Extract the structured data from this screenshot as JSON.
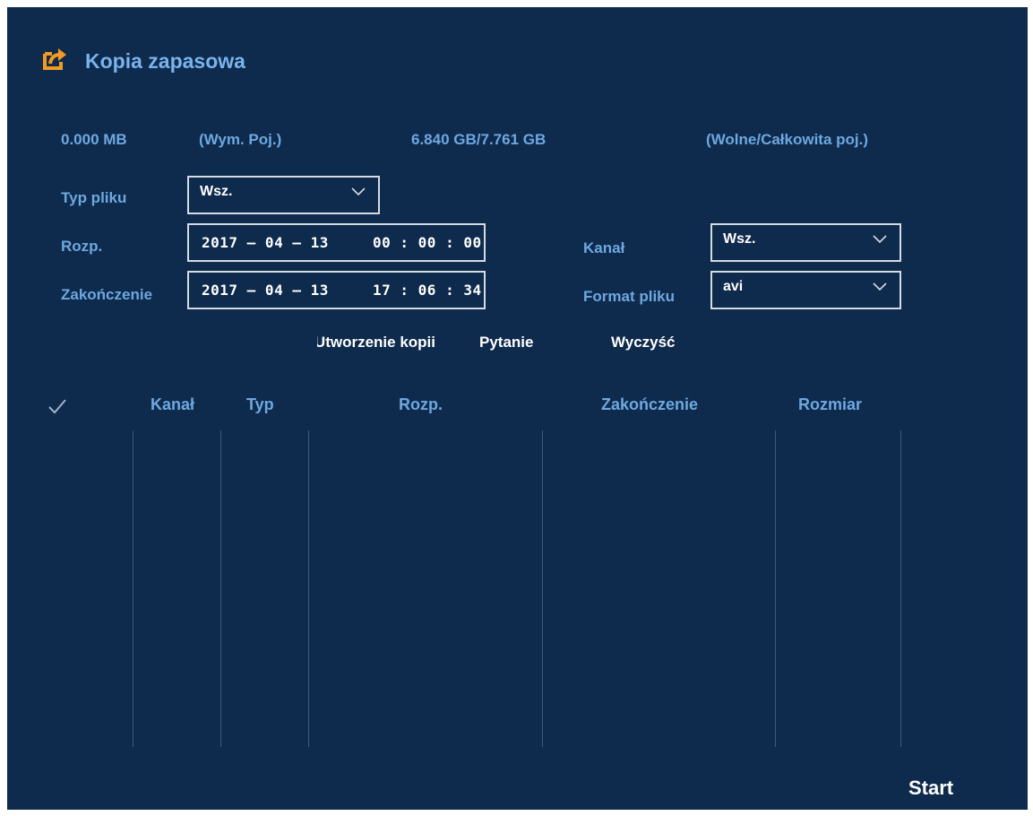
{
  "header": {
    "title": "Kopia zapasowa",
    "icon": "export-icon",
    "accent": "#f29b22"
  },
  "storage": {
    "size_value": "0.000 MB",
    "size_label": "(Wym. Poj.)",
    "capacity_value": "6.840 GB/7.761 GB",
    "capacity_label": "(Wolne/Całkowita poj.)"
  },
  "form": {
    "file_type_label": "Typ pliku",
    "file_type_value": "Wsz.",
    "start_label": "Rozp.",
    "start_date": "2017 – 04 – 13",
    "start_time": "00 : 00 : 00",
    "end_label": "Zakończenie",
    "end_date": "2017 – 04 – 13",
    "end_time": "17 : 06 : 34",
    "channel_label": "Kanał",
    "channel_value": "Wsz.",
    "format_label": "Format pliku",
    "format_value": "avi"
  },
  "actions": {
    "create_backup": "Utworzenie kopii",
    "query": "Pytanie",
    "clear": "Wyczyść"
  },
  "table": {
    "columns": [
      "✓",
      "Kanał",
      "Typ",
      "Rozp.",
      "Zakończenie",
      "Rozmiar"
    ],
    "rows": []
  },
  "footer": {
    "start_label": "Start"
  },
  "colors": {
    "background": "#0e2a4c",
    "label": "#6ea8e0",
    "text": "#ffffff",
    "border": "#d5dbe3"
  }
}
